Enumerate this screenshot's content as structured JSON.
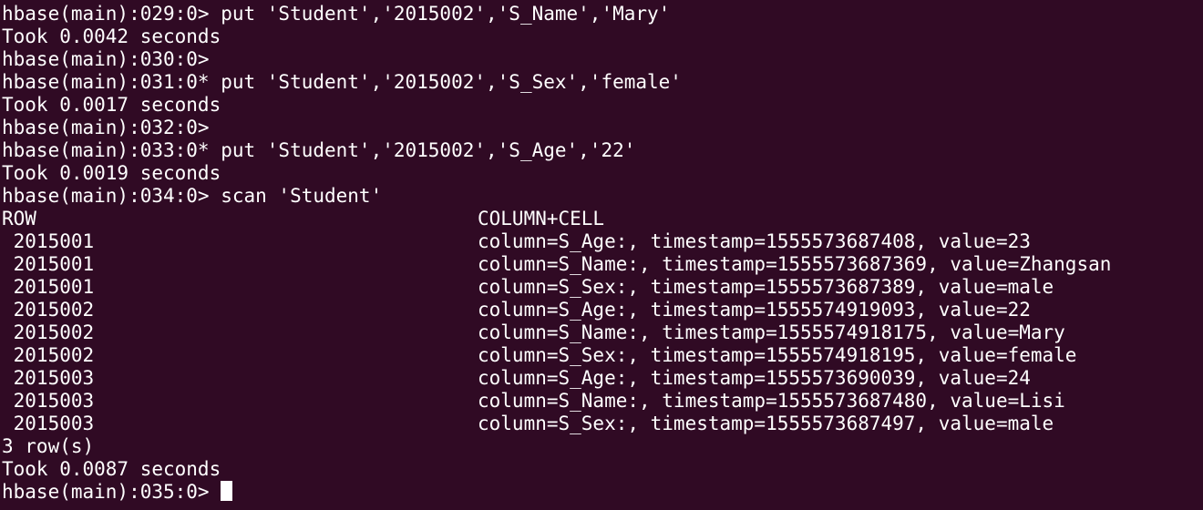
{
  "terminal": {
    "background": "#300a24",
    "foreground": "#ffffff",
    "history": [
      "hbase(main):029:0> put 'Student','2015002','S_Name','Mary'",
      "Took 0.0042 seconds",
      "hbase(main):030:0>",
      "hbase(main):031:0* put 'Student','2015002','S_Sex','female'",
      "Took 0.0017 seconds",
      "hbase(main):032:0>",
      "hbase(main):033:0* put 'Student','2015002','S_Age','22'",
      "Took 0.0019 seconds",
      "hbase(main):034:0> scan 'Student'"
    ],
    "scan": {
      "header": {
        "row": "ROW",
        "cell": "COLUMN+CELL"
      },
      "rows": [
        {
          "row": " 2015001",
          "cell": "column=S_Age:, timestamp=1555573687408, value=23"
        },
        {
          "row": " 2015001",
          "cell": "column=S_Name:, timestamp=1555573687369, value=Zhangsan"
        },
        {
          "row": " 2015001",
          "cell": "column=S_Sex:, timestamp=1555573687389, value=male"
        },
        {
          "row": " 2015002",
          "cell": "column=S_Age:, timestamp=1555574919093, value=22"
        },
        {
          "row": " 2015002",
          "cell": "column=S_Name:, timestamp=1555574918175, value=Mary"
        },
        {
          "row": " 2015002",
          "cell": "column=S_Sex:, timestamp=1555574918195, value=female"
        },
        {
          "row": " 2015003",
          "cell": "column=S_Age:, timestamp=1555573690039, value=24"
        },
        {
          "row": " 2015003",
          "cell": "column=S_Name:, timestamp=1555573687480, value=Lisi"
        },
        {
          "row": " 2015003",
          "cell": "column=S_Sex:, timestamp=1555573687497, value=male"
        }
      ],
      "summary": "3 row(s)",
      "took": "Took 0.0087 seconds"
    },
    "prompt": "hbase(main):035:0> "
  }
}
